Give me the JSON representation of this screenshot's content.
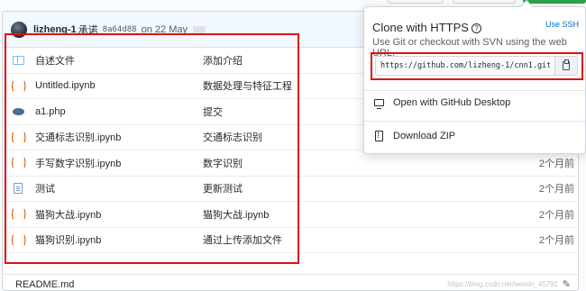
{
  "commit": {
    "user": "lizheng-1",
    "verb": "承诺",
    "sha": "8a64d88",
    "date": "on 22 May"
  },
  "files": [
    {
      "icon": "book-icon",
      "name": "自述文件",
      "message": "添加介绍",
      "age": ""
    },
    {
      "icon": "notebook-icon",
      "name": "Untitled.ipynb",
      "message": "数据处理与特征工程",
      "age": ""
    },
    {
      "icon": "php-file-icon",
      "name": "a1.php",
      "message": "提交",
      "age": ""
    },
    {
      "icon": "notebook-icon",
      "name": "交通标志识别.ipynb",
      "message": "交通标志识别",
      "age": ""
    },
    {
      "icon": "notebook-icon",
      "name": "手写数字识别.ipynb",
      "message": "数字识别",
      "age": "2个月前"
    },
    {
      "icon": "file-icon",
      "name": "测试",
      "message": "更新测试",
      "age": "2个月前"
    },
    {
      "icon": "notebook-icon",
      "name": "猫狗大战.ipynb",
      "message": "猫狗大战.ipynb",
      "age": "2个月前"
    },
    {
      "icon": "notebook-icon",
      "name": "猫狗识别.ipynb",
      "message": "通过上传添加文件",
      "age": "2个月前"
    }
  ],
  "readme": {
    "title": "README.md",
    "watermark": "https://blog.csdn.net/weixin_45791"
  },
  "clone": {
    "title": "Clone with HTTPS",
    "use_ssh": "Use SSH",
    "description": "Use Git or checkout with SVN using the web URL.",
    "url": "https://github.com/lizheng-1/cnn1.git",
    "open_desktop": "Open with GitHub Desktop",
    "download_zip": "Download ZIP"
  },
  "colors": {
    "highlight_red": "#dd1111",
    "link_blue": "#0366d6",
    "notebook_orange": "#e36209"
  }
}
